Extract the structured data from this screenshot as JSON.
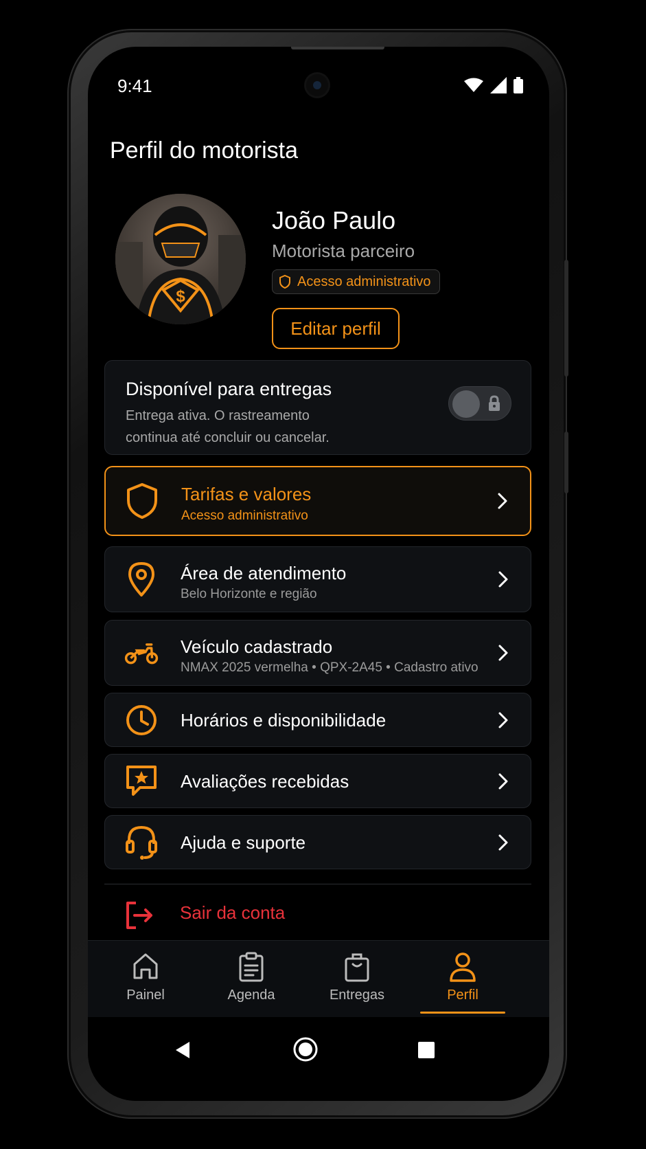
{
  "status_bar": {
    "time": "9:41"
  },
  "page_title": "Perfil do motorista",
  "profile": {
    "name": "João Paulo",
    "role": "Motorista parceiro",
    "badge": "Acesso administrativo",
    "edit_button": "Editar perfil"
  },
  "availability": {
    "title": "Disponível para entregas",
    "subtitle": "Entrega ativa. O rastreamento continua até concluir ou cancelar.",
    "toggle_on": false,
    "locked": true
  },
  "menu": [
    {
      "title": "Tarifas e valores",
      "subtitle": "Acesso administrativo",
      "icon": "shield-icon",
      "active": true
    },
    {
      "title": "Área de atendimento",
      "subtitle": "Belo Horizonte e região",
      "icon": "location-pin-icon",
      "active": false
    },
    {
      "title": "Veículo cadastrado",
      "subtitle": "NMAX 2025 vermelha • QPX-2A45 • Cadastro ativo",
      "icon": "motorcycle-icon",
      "active": false
    },
    {
      "title": "Horários e disponibilidade",
      "subtitle": "",
      "icon": "clock-icon",
      "active": false
    },
    {
      "title": "Avaliações recebidas",
      "subtitle": "",
      "icon": "star-message-icon",
      "active": false
    },
    {
      "title": "Ajuda e suporte",
      "subtitle": "",
      "icon": "headset-icon",
      "active": false
    }
  ],
  "logout": {
    "label": "Sair da conta",
    "icon": "logout-icon"
  },
  "bottom_nav": [
    {
      "label": "Painel",
      "icon": "home-icon",
      "active": false
    },
    {
      "label": "Agenda",
      "icon": "clipboard-icon",
      "active": false
    },
    {
      "label": "Entregas",
      "icon": "bag-icon",
      "active": false
    },
    {
      "label": "Perfil",
      "icon": "user-icon",
      "active": true
    }
  ],
  "colors": {
    "accent": "#f39218",
    "danger": "#e8323a",
    "background": "#000000",
    "card": "#0f1114"
  }
}
